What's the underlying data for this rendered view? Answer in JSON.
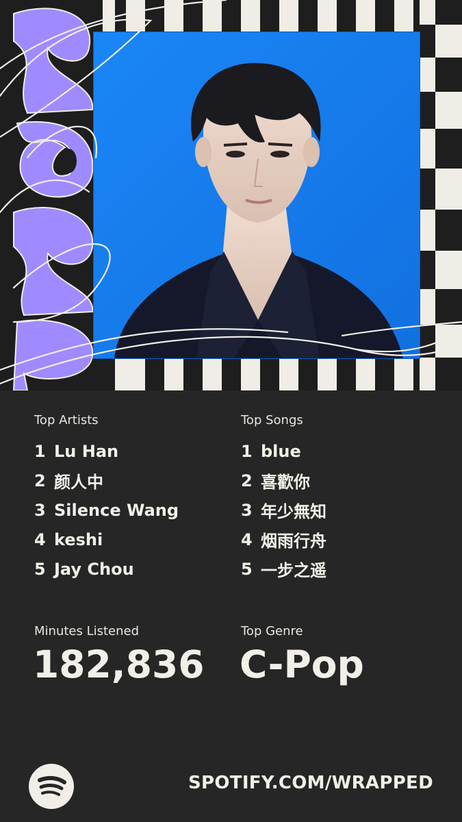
{
  "wrapped": {
    "year_graphic": "2025",
    "artist_photo_alt": "Lu Han portrait",
    "colors": {
      "background": "#262626",
      "accent_purple": "#9f8bff",
      "photo_blue": "#1583f5",
      "text": "#f1efe7"
    }
  },
  "top_artists": {
    "label": "Top Artists",
    "items": [
      {
        "rank": "1",
        "name": "Lu Han"
      },
      {
        "rank": "2",
        "name": "颜人中"
      },
      {
        "rank": "3",
        "name": "Silence Wang"
      },
      {
        "rank": "4",
        "name": "keshi"
      },
      {
        "rank": "5",
        "name": "Jay Chou"
      }
    ]
  },
  "top_songs": {
    "label": "Top Songs",
    "items": [
      {
        "rank": "1",
        "name": "blue"
      },
      {
        "rank": "2",
        "name": "喜歡你"
      },
      {
        "rank": "3",
        "name": "年少無知"
      },
      {
        "rank": "4",
        "name": "烟雨行舟"
      },
      {
        "rank": "5",
        "name": "一步之遥"
      }
    ]
  },
  "minutes": {
    "label": "Minutes Listened",
    "value": "182,836"
  },
  "genre": {
    "label": "Top Genre",
    "value": "C-Pop"
  },
  "footer": {
    "logo_icon": "spotify-icon",
    "url": "SPOTIFY.COM/WRAPPED"
  }
}
